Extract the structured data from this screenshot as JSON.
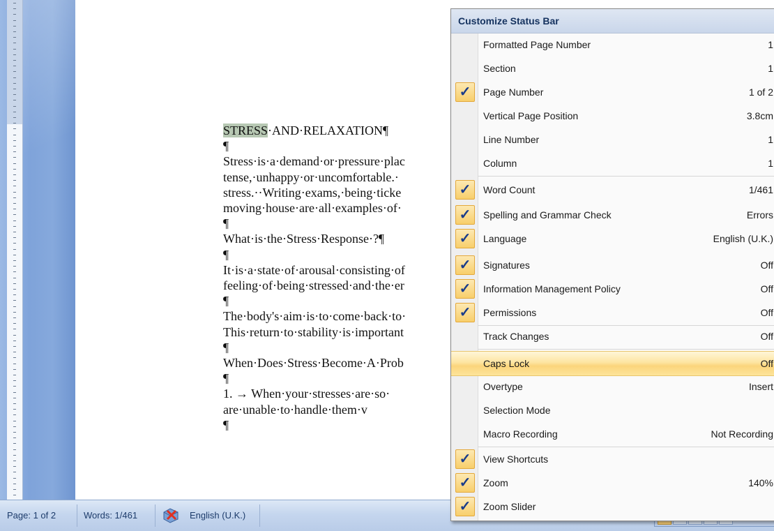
{
  "document": {
    "lines": [
      {
        "text": "STRESS",
        "rest": "·AND·RELAXATION¶",
        "highlight": true
      },
      {
        "text": "¶"
      },
      {
        "text": "Stress·is·a·demand·or·pressure·plac"
      },
      {
        "text": "tense,·unhappy·or·uncomfortable.·"
      },
      {
        "text": "stress.··Writing·exams,·being·ticke"
      },
      {
        "text": "moving·house·are·all·examples·of·"
      },
      {
        "text": "¶"
      },
      {
        "text": "What·is·the·Stress·Response·?¶"
      },
      {
        "text": "¶"
      },
      {
        "text": "It·is·a·state·of·arousal·consisting·of"
      },
      {
        "text": "feeling·of·being·stressed·and·the·er"
      },
      {
        "text": "¶"
      },
      {
        "text": "The·body's·aim·is·to·come·back·to·"
      },
      {
        "text": "This·return·to·stability·is·important"
      },
      {
        "text": "¶"
      },
      {
        "text": "When·Does·Stress·Become·A·Prob"
      },
      {
        "text": "¶"
      },
      {
        "text": "1.  →   When·your·stresses·are·so·"
      },
      {
        "text": "           are·unable·to·handle·them·v"
      },
      {
        "text": "¶"
      }
    ]
  },
  "status_bar": {
    "page": "Page: 1 of 2",
    "words": "Words: 1/461",
    "language": "English (U.K.)",
    "proofing_icon": "proofing-error-icon"
  },
  "menu": {
    "title": "Customize Status Bar",
    "items": [
      {
        "label": "Formatted Page Number",
        "value": "1",
        "checked": false
      },
      {
        "label": "Section",
        "value": "1",
        "checked": false
      },
      {
        "label": "Page Number",
        "value": "1 of 2",
        "checked": true
      },
      {
        "label": "Vertical Page Position",
        "value": "3.8cm",
        "checked": false
      },
      {
        "label": "Line Number",
        "value": "1",
        "checked": false
      },
      {
        "label": "Column",
        "value": "1",
        "checked": false
      },
      {
        "label": "Word Count",
        "value": "1/461",
        "checked": true
      },
      {
        "label": "Spelling and Grammar Check",
        "value": "Errors",
        "checked": true
      },
      {
        "label": "Language",
        "value": "English (U.K.)",
        "checked": true
      },
      {
        "label": "Signatures",
        "value": "Off",
        "checked": true
      },
      {
        "label": "Information Management Policy",
        "value": "Off",
        "checked": true
      },
      {
        "label": "Permissions",
        "value": "Off",
        "checked": true
      },
      {
        "label": "Track Changes",
        "value": "Off",
        "checked": false
      },
      {
        "label": "Caps Lock",
        "value": "Off",
        "checked": false,
        "hover": true
      },
      {
        "label": "Overtype",
        "value": "Insert",
        "checked": false
      },
      {
        "label": "Selection Mode",
        "value": "",
        "checked": false
      },
      {
        "label": "Macro Recording",
        "value": "Not Recording",
        "checked": false
      },
      {
        "label": "View Shortcuts",
        "value": "",
        "checked": true
      },
      {
        "label": "Zoom",
        "value": "140%",
        "checked": true
      },
      {
        "label": "Zoom Slider",
        "value": "",
        "checked": true
      }
    ],
    "check_glyph": "✓"
  },
  "colors": {
    "menu_hover": "#fbd57c",
    "check_bg": "#f8cf6b",
    "title_text": "#15325f"
  }
}
